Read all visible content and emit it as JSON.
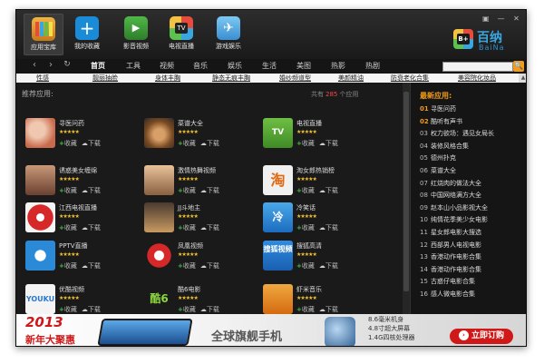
{
  "header": {
    "apps": [
      {
        "label": "应用宝库",
        "icon": "app-library-icon"
      },
      {
        "label": "我的收藏",
        "icon": "favorites-plus-icon"
      },
      {
        "label": "影音视频",
        "icon": "video-play-icon"
      },
      {
        "label": "电视直播",
        "icon": "tv-live-icon"
      },
      {
        "label": "游戏娱乐",
        "icon": "game-plane-icon"
      }
    ],
    "brand_cn": "百纳",
    "brand_en": "BaiNa",
    "window_buttons": [
      "▣",
      "—",
      "✕"
    ]
  },
  "nav": {
    "tabs": [
      "首页",
      "工具",
      "视频",
      "音乐",
      "娱乐",
      "生活",
      "美图",
      "热影",
      "热剧"
    ],
    "active_tab": "首页",
    "search_placeholder": "",
    "search_icon": "🔍"
  },
  "subnav": {
    "links": [
      "性感",
      "靓丽抽脸",
      "身体丰胸",
      "静态无痕丰胸",
      "婚纱频道型",
      "美颜精油",
      "防衰老化合集",
      "美容院化妆品"
    ]
  },
  "main": {
    "heading": "推荐应用:",
    "total_prefix": "共有",
    "total_count": "285",
    "total_suffix": "个应用",
    "fav_label": "收藏",
    "dl_label": "下载",
    "stars": "★★★★★",
    "apps": [
      {
        "name": "寻医问药",
        "thumb": ""
      },
      {
        "name": "菜谱大全",
        "thumb": ""
      },
      {
        "name": "电视直播",
        "thumb": "TV"
      },
      {
        "name": "诱惑美女缠绵",
        "thumb": ""
      },
      {
        "name": "激情热舞视频",
        "thumb": ""
      },
      {
        "name": "淘女郎热销榜",
        "thumb": "淘"
      },
      {
        "name": "江西电视直播",
        "thumb": ""
      },
      {
        "name": "JJ斗地主",
        "thumb": ""
      },
      {
        "name": "冷笑话",
        "thumb": "冷"
      },
      {
        "name": "PPTV直播",
        "thumb": ""
      },
      {
        "name": "凤凰视频",
        "thumb": ""
      },
      {
        "name": "搜狐高清",
        "thumb": "搜狐视频"
      },
      {
        "name": "优酷视频",
        "thumb": "YOUKU"
      },
      {
        "name": "酷6电影",
        "thumb": "酷6"
      },
      {
        "name": "虾米音乐",
        "thumb": ""
      }
    ]
  },
  "side": {
    "title": "最新应用:",
    "items": [
      {
        "n": "01",
        "name": "寻医问药"
      },
      {
        "n": "02",
        "name": "酷听有声书"
      },
      {
        "n": "03",
        "name": "权力欲场：遇见女局长"
      },
      {
        "n": "04",
        "name": "装修风格合集"
      },
      {
        "n": "05",
        "name": "德州扑克"
      },
      {
        "n": "06",
        "name": "菜谱大全"
      },
      {
        "n": "07",
        "name": "红烧肉的做法大全"
      },
      {
        "n": "08",
        "name": "中国网络满方大全"
      },
      {
        "n": "09",
        "name": "赵本山小品影视大全"
      },
      {
        "n": "10",
        "name": "纯情花季美少女电影"
      },
      {
        "n": "11",
        "name": "星女郎电影大搜选"
      },
      {
        "n": "12",
        "name": "西部男人电视电影"
      },
      {
        "n": "13",
        "name": "香港动作电影合集"
      },
      {
        "n": "14",
        "name": "香港动作电影合集"
      },
      {
        "n": "15",
        "name": "古惑仔电影合集"
      },
      {
        "n": "16",
        "name": "感人微电影合集"
      }
    ]
  },
  "banner": {
    "year": "2013",
    "sale": "新年大聚惠",
    "slogan": "全球旗舰手机",
    "specs": [
      "8.6毫米机身",
      "4.8寸超大屏幕",
      "1.4G四核处理器"
    ],
    "order": "立即订购",
    "order_icon": "›"
  }
}
